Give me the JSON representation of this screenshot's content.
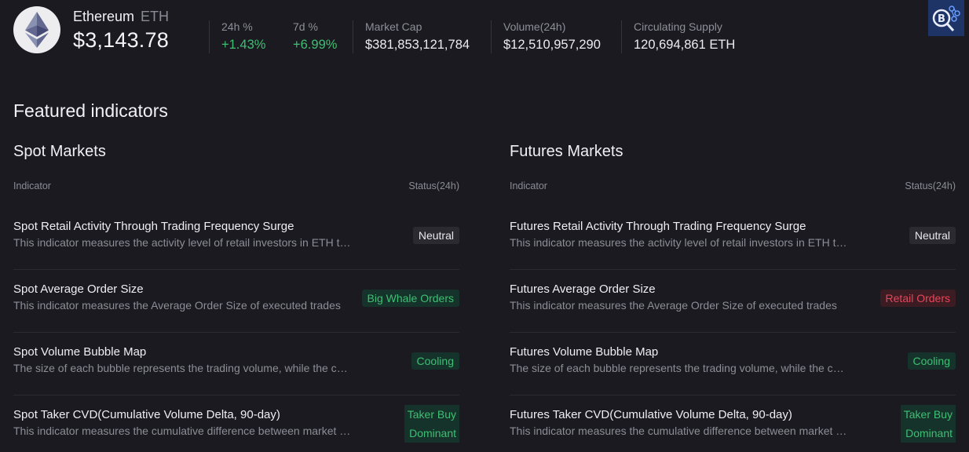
{
  "coin": {
    "name": "Ethereum",
    "symbol": "ETH",
    "price": "$3,143.78"
  },
  "stats": [
    {
      "label": "24h %",
      "value": "+1.43%",
      "trend": "up"
    },
    {
      "label": "7d %",
      "value": "+6.99%",
      "trend": "up"
    },
    {
      "label": "Market Cap",
      "value": "$381,853,121,784",
      "trend": "none"
    },
    {
      "label": "Volume(24h)",
      "value": "$12,510,957,290",
      "trend": "none"
    },
    {
      "label": "Circulating Supply",
      "value": "120,694,861 ETH",
      "trend": "none"
    }
  ],
  "featured_title": "Featured indicators",
  "spot": {
    "title": "Spot Markets",
    "col_indicator": "Indicator",
    "col_status": "Status(24h)",
    "rows": [
      {
        "name": "Spot Retail Activity Through Trading Frequency Surge",
        "desc": "This indicator measures the activity level of retail investors in ETH through trading frequency surge",
        "status": "Neutral",
        "status_line1": "",
        "status_line2": ""
      },
      {
        "name": "Spot Average Order Size",
        "desc": "This indicator measures the Average Order Size of executed trades",
        "status": "Big Whale Orders",
        "status_line1": "",
        "status_line2": ""
      },
      {
        "name": "Spot Volume Bubble Map",
        "desc": "The size of each bubble represents the trading volume, while the color",
        "status": "Cooling",
        "status_line1": "",
        "status_line2": ""
      },
      {
        "name": "Spot Taker CVD(Cumulative Volume Delta, 90-day)",
        "desc": "This indicator measures the cumulative difference between market buy and sell",
        "status": "",
        "status_line1": "Taker Buy",
        "status_line2": "Dominant"
      }
    ]
  },
  "futures": {
    "title": "Futures Markets",
    "col_indicator": "Indicator",
    "col_status": "Status(24h)",
    "rows": [
      {
        "name": "Futures Retail Activity Through Trading Frequency Surge",
        "desc": "This indicator measures the activity level of retail investors in ETH through trading frequency surge",
        "status": "Neutral",
        "status_line1": "",
        "status_line2": ""
      },
      {
        "name": "Futures Average Order Size",
        "desc": "This indicator measures the Average Order Size of executed trades",
        "status": "Retail Orders",
        "status_line1": "",
        "status_line2": ""
      },
      {
        "name": "Futures Volume Bubble Map",
        "desc": "The size of each bubble represents the trading volume, while the color",
        "status": "Cooling",
        "status_line1": "",
        "status_line2": ""
      },
      {
        "name": "Futures Taker CVD(Cumulative Volume Delta, 90-day)",
        "desc": "This indicator measures the cumulative difference between market buy and sell",
        "status": "",
        "status_line1": "Taker Buy",
        "status_line2": "Dominant"
      }
    ]
  },
  "colors": {
    "background": "#1a1a20",
    "positive": "#3fbf73",
    "negative": "#e8455a",
    "muted": "#8d8d97"
  }
}
